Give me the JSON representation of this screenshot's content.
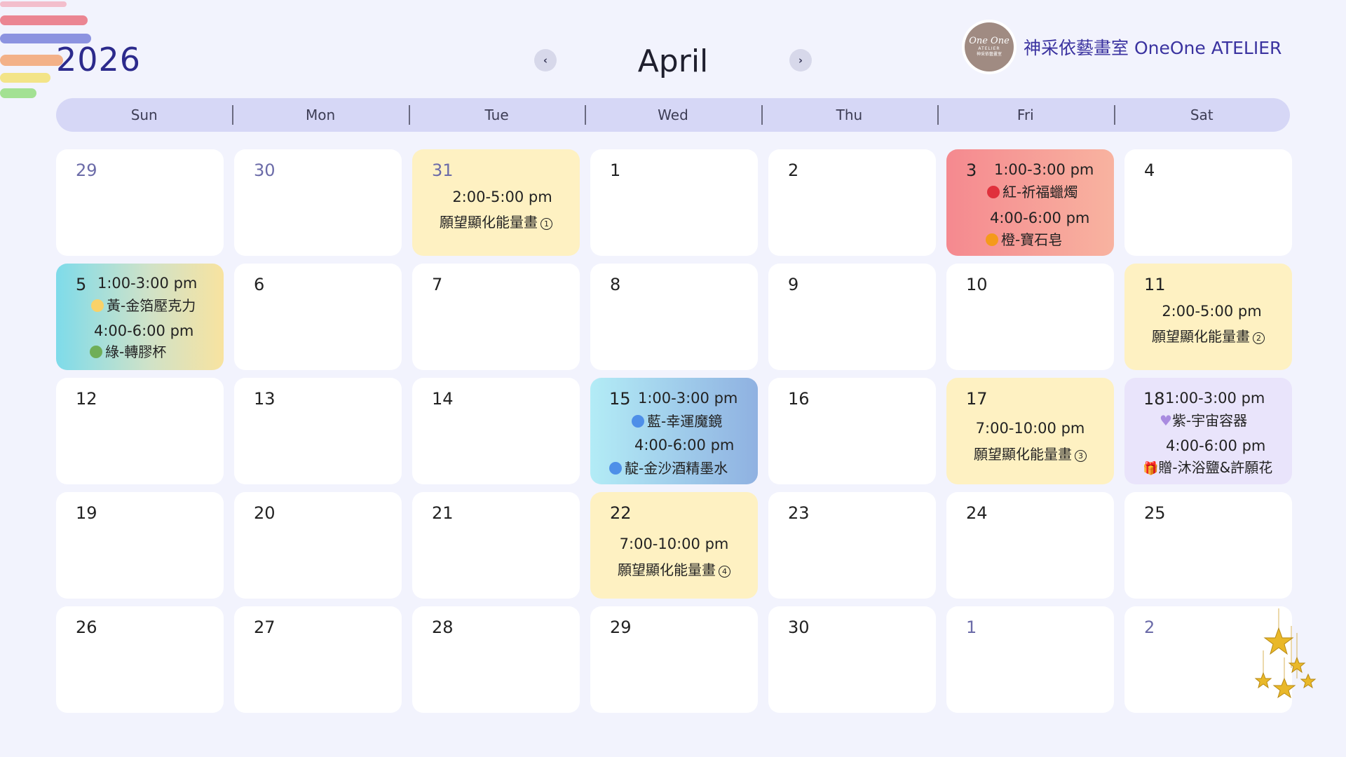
{
  "header": {
    "year": "2026",
    "month": "April",
    "prev_label": "‹",
    "next_label": "›",
    "brand_name": "神采依藝畫室 OneOne ATELIER",
    "logo_line1": "One One",
    "logo_line2": "ATELIER",
    "logo_line3": "神采依藝畫室"
  },
  "weekdays": [
    "Sun",
    "Mon",
    "Tue",
    "Wed",
    "Thu",
    "Fri",
    "Sat"
  ],
  "colors": {
    "red_dot": "#e0303c",
    "orange_dot": "#f59a1b",
    "yellow_dot": "#f9d269",
    "green_dot": "#6fae58",
    "blue_dot": "#4e8fe8",
    "navy_dot": "#4e8fe8"
  },
  "cells": [
    {
      "day": "29"
    },
    {
      "day": "30"
    },
    {
      "day": "31",
      "time1": "2:00-5:00 pm",
      "title1": "願望顯化能量畫",
      "badge1": "1"
    },
    {
      "day": "1"
    },
    {
      "day": "2"
    },
    {
      "day": "3",
      "time1": "1:00-3:00 pm",
      "title1": "紅-祈福蠟燭",
      "time2": "4:00-6:00 pm",
      "title2": "橙-寶石皂"
    },
    {
      "day": "4"
    },
    {
      "day": "5",
      "time1": "1:00-3:00 pm",
      "title1": "黃-金箔壓克力",
      "time2": "4:00-6:00 pm",
      "title2": "綠-轉膠杯"
    },
    {
      "day": "6"
    },
    {
      "day": "7"
    },
    {
      "day": "8"
    },
    {
      "day": "9"
    },
    {
      "day": "10"
    },
    {
      "day": "11",
      "time1": "2:00-5:00 pm",
      "title1": "願望顯化能量畫",
      "badge1": "2"
    },
    {
      "day": "12"
    },
    {
      "day": "13"
    },
    {
      "day": "14"
    },
    {
      "day": "15",
      "time1": "1:00-3:00 pm",
      "title1": "藍-幸運魔鏡",
      "time2": "4:00-6:00 pm",
      "title2": "靛-金沙酒精墨水"
    },
    {
      "day": "16"
    },
    {
      "day": "17",
      "time1": "7:00-10:00 pm",
      "title1": "願望顯化能量畫",
      "badge1": "3"
    },
    {
      "day": "18",
      "time1": "1:00-3:00 pm",
      "title1": "紫-宇宙容器",
      "time2": "4:00-6:00 pm",
      "title2": "贈-沐浴鹽&許願花"
    },
    {
      "day": "19"
    },
    {
      "day": "20"
    },
    {
      "day": "21"
    },
    {
      "day": "22",
      "time1": "7:00-10:00 pm",
      "title1": "願望顯化能量畫",
      "badge1": "4"
    },
    {
      "day": "23"
    },
    {
      "day": "24"
    },
    {
      "day": "25"
    },
    {
      "day": "26"
    },
    {
      "day": "27"
    },
    {
      "day": "28"
    },
    {
      "day": "29"
    },
    {
      "day": "30"
    },
    {
      "day": "1"
    },
    {
      "day": "2"
    }
  ]
}
